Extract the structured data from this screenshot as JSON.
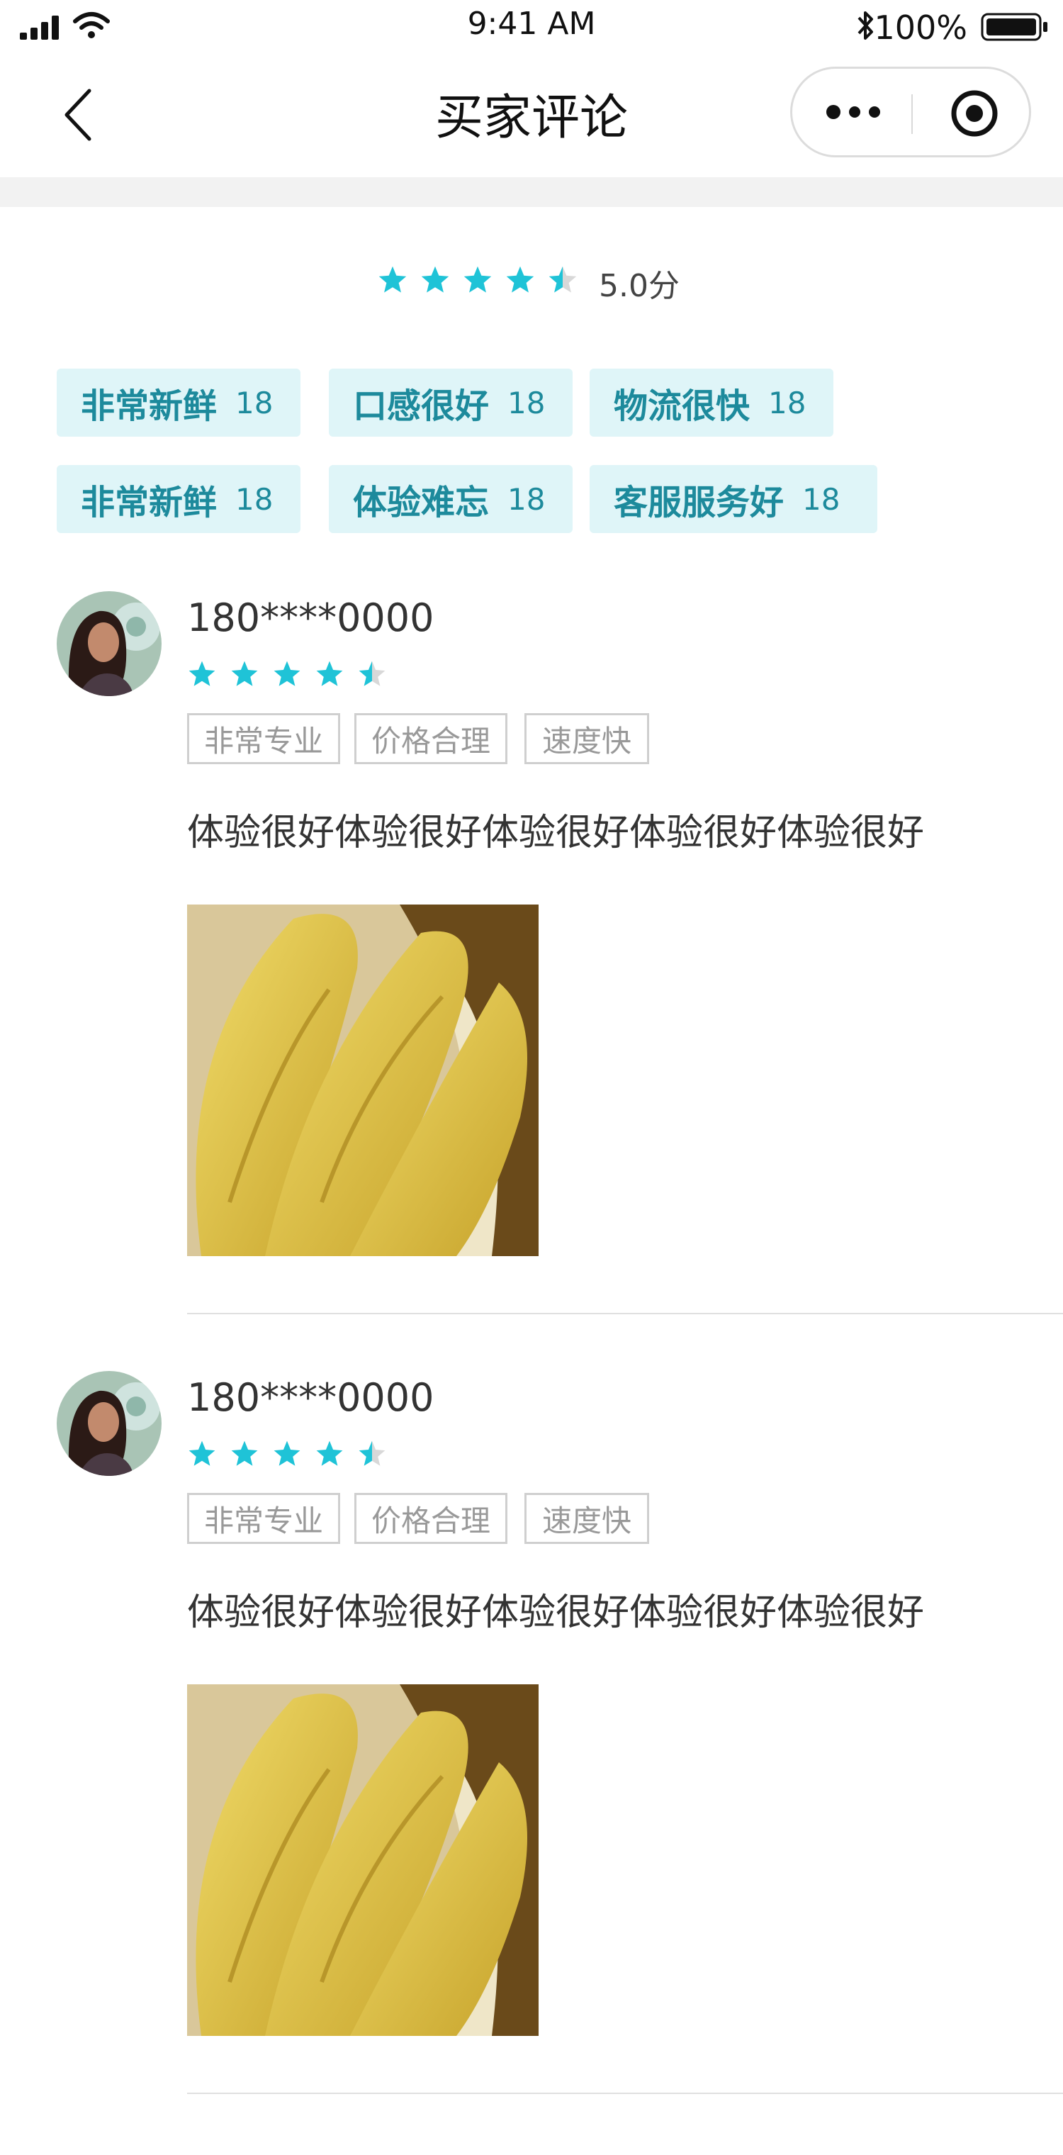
{
  "status_bar": {
    "time": "9:41 AM",
    "battery_percent": "100%"
  },
  "nav": {
    "title": "买家评论"
  },
  "summary": {
    "rating": 4.5,
    "score_text": "5.0分"
  },
  "tags": [
    {
      "name": "非常新鲜",
      "count": "18"
    },
    {
      "name": "口感很好",
      "count": "18"
    },
    {
      "name": "物流很快",
      "count": "18"
    },
    {
      "name": "非常新鲜",
      "count": "18"
    },
    {
      "name": "体验难忘",
      "count": "18"
    },
    {
      "name": "客服服务好",
      "count": "18"
    }
  ],
  "reviews": [
    {
      "user": "180****0000",
      "rating": 4.5,
      "tags": [
        "非常专业",
        "价格合理",
        "速度快"
      ],
      "text": "体验很好体验很好体验很好体验很好体验很好"
    },
    {
      "user": "180****0000",
      "rating": 4.5,
      "tags": [
        "非常专业",
        "价格合理",
        "速度快"
      ],
      "text": "体验很好体验很好体验很好体验很好体验很好"
    }
  ],
  "colors": {
    "accent": "#1fc3d7",
    "tag_bg": "#dff5f8",
    "tag_text": "#1d8a9c"
  },
  "icons": [
    "signal-icon",
    "wifi-icon",
    "bluetooth-icon",
    "battery-icon",
    "back-arrow-icon",
    "more-dots-icon",
    "close-target-icon",
    "star-icon"
  ]
}
